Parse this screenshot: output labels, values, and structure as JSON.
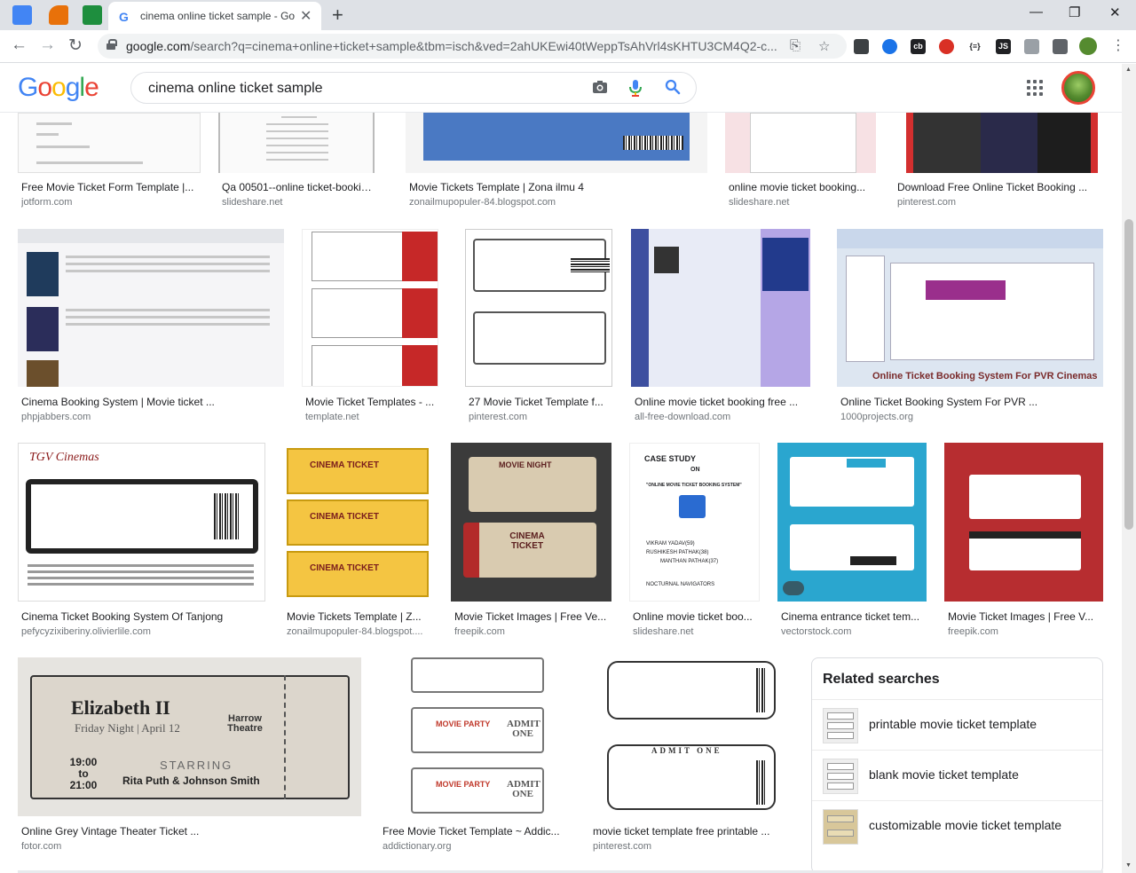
{
  "browser": {
    "tab_title": "cinema online ticket sample - Go",
    "url_host": "google.com",
    "url_rest": "/search?q=cinema+online+ticket+sample&tbm=isch&ved=2ahUKEwi40tWeppTsAhVrl4sKHTU3CM4Q2-c..."
  },
  "google": {
    "logo_letters": [
      "G",
      "o",
      "o",
      "g",
      "l",
      "e"
    ],
    "logo_colors": [
      "#4285f4",
      "#ea4335",
      "#fbbc05",
      "#4285f4",
      "#34a853",
      "#ea4335"
    ],
    "query": "cinema online ticket sample"
  },
  "results": [
    {
      "caption": "Free Movie Ticket Form Template |...",
      "source": "jotform.com"
    },
    {
      "caption": "Qa 00501--online ticket-booking...",
      "source": "slideshare.net"
    },
    {
      "caption": "Movie Tickets Template | Zona ilmu 4",
      "source": "zonailmupopuler-84.blogspot.com"
    },
    {
      "caption": "online movie ticket booking...",
      "source": "slideshare.net"
    },
    {
      "caption": "Download Free Online Ticket Booking ...",
      "source": "pinterest.com"
    },
    {
      "caption": "Cinema Booking System | Movie ticket ...",
      "source": "phpjabbers.com"
    },
    {
      "caption": "Movie Ticket Templates - ...",
      "source": "template.net"
    },
    {
      "caption": "27 Movie Ticket Template f...",
      "source": "pinterest.com"
    },
    {
      "caption": "Online movie ticket booking free ...",
      "source": "all-free-download.com"
    },
    {
      "caption": "Online Ticket Booking System For PVR ...",
      "source": "1000projects.org"
    },
    {
      "caption": "Cinema Ticket Booking System Of Tanjong",
      "source": "pefycyzixiberiny.olivierlile.com"
    },
    {
      "caption": "Movie Tickets Template | Z...",
      "source": "zonailmupopuler-84.blogspot...."
    },
    {
      "caption": "Movie Ticket Images | Free Ve...",
      "source": "freepik.com"
    },
    {
      "caption": "Online movie ticket boo...",
      "source": "slideshare.net"
    },
    {
      "caption": "Cinema entrance ticket tem...",
      "source": "vectorstock.com"
    },
    {
      "caption": "Movie Ticket Images | Free V...",
      "source": "freepik.com"
    },
    {
      "caption": "Online Grey Vintage Theater Ticket ...",
      "source": "fotor.com"
    },
    {
      "caption": "Free Movie Ticket Template ~ Addic...",
      "source": "addictionary.org"
    },
    {
      "caption": "movie ticket template free printable ...",
      "source": "pinterest.com"
    }
  ],
  "thumb_text": {
    "pvr_title": "Online Ticket Booking System For PVR Cinemas",
    "tgv": "TGV Cinemas",
    "movie_night": "MOVIE NIGHT",
    "cinema_ticket": "CINEMA TICKET",
    "case_study": "CASE STUDY",
    "case_study_on": "ON",
    "case_study_sub": "\"ONLINE MOVIE TICKET BOOKING SYSTEM\"",
    "case_names": [
      "VIKRAM YADAV(59)",
      "RUSHIKESH PATHAK(38)",
      "MANTHAN PATHAK(37)"
    ],
    "case_team": "NOCTURNAL NAVIGATORS",
    "eliz_title": "Elizabeth II",
    "eliz_sub": "Friday Night | April 12",
    "eliz_venue": "Harrow Theatre",
    "eliz_time": "19:00 to 21:00",
    "eliz_star_label": "STARRING",
    "eliz_star": "Rita Puth & Johnson Smith",
    "admit_one": "ADMIT ONE",
    "movie_party": "MOVIE PARTY",
    "gold_ticket": "CINEMA TICKET"
  },
  "related": {
    "heading": "Related searches",
    "items": [
      {
        "label": "printable movie ticket template"
      },
      {
        "label": "blank movie ticket template"
      },
      {
        "label": "customizable movie ticket template"
      }
    ]
  }
}
